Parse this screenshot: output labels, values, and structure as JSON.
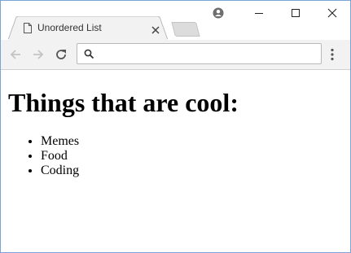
{
  "browser": {
    "tab_title": "Unordered List",
    "address_value": "",
    "address_placeholder": ""
  },
  "icons": {
    "page": "page-icon",
    "tab_close": "close-icon",
    "new_tab": "new-tab-icon",
    "profile": "profile-icon",
    "minimize": "minimize-icon",
    "maximize": "maximize-icon",
    "window_close": "close-icon",
    "back": "back-arrow-icon",
    "forward": "forward-arrow-icon",
    "reload": "reload-icon",
    "search": "search-icon",
    "menu": "menu-dots-icon"
  },
  "colors": {
    "window_border": "#7aa3d6",
    "toolbar_bg": "#f2f2f2",
    "tab_bg": "#f2f2f2"
  },
  "page": {
    "heading": "Things that are cool:",
    "items": [
      "Memes",
      "Food",
      "Coding"
    ]
  }
}
